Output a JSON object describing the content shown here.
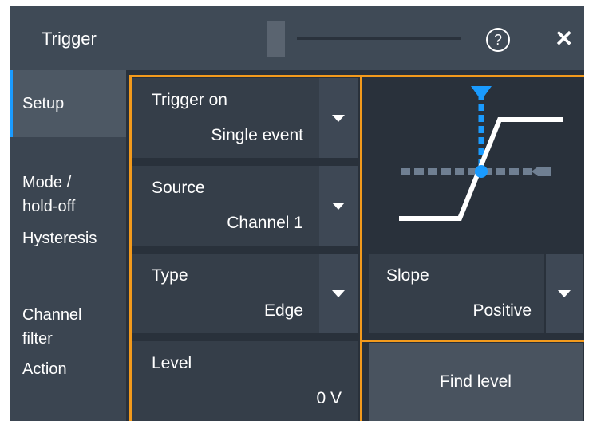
{
  "dialog": {
    "title": "Trigger",
    "help_glyph": "?",
    "close_glyph": "✕"
  },
  "sidebar": {
    "items": [
      {
        "label": "Setup"
      },
      {
        "label": "Mode /\nhold-off"
      },
      {
        "label": "Hysteresis"
      },
      {
        "label": "Channel\nfilter"
      },
      {
        "label": "Action"
      }
    ]
  },
  "fields": {
    "trigger_on": {
      "label": "Trigger on",
      "value": "Single event"
    },
    "source": {
      "label": "Source",
      "value": "Channel 1"
    },
    "type": {
      "label": "Type",
      "value": "Edge"
    },
    "slope": {
      "label": "Slope",
      "value": "Positive"
    },
    "level": {
      "label": "Level",
      "value": "0 V"
    }
  },
  "buttons": {
    "find_level": "Find level"
  },
  "icons": {
    "help": "help-icon",
    "close": "close-icon",
    "dropdown": "chevron-down-icon",
    "edge_graphic": "positive-edge-trigger-icon"
  },
  "colors": {
    "accent_blue": "#1a9bff",
    "highlight_orange": "#f39a1c",
    "dialog_bg": "#3b4551"
  }
}
